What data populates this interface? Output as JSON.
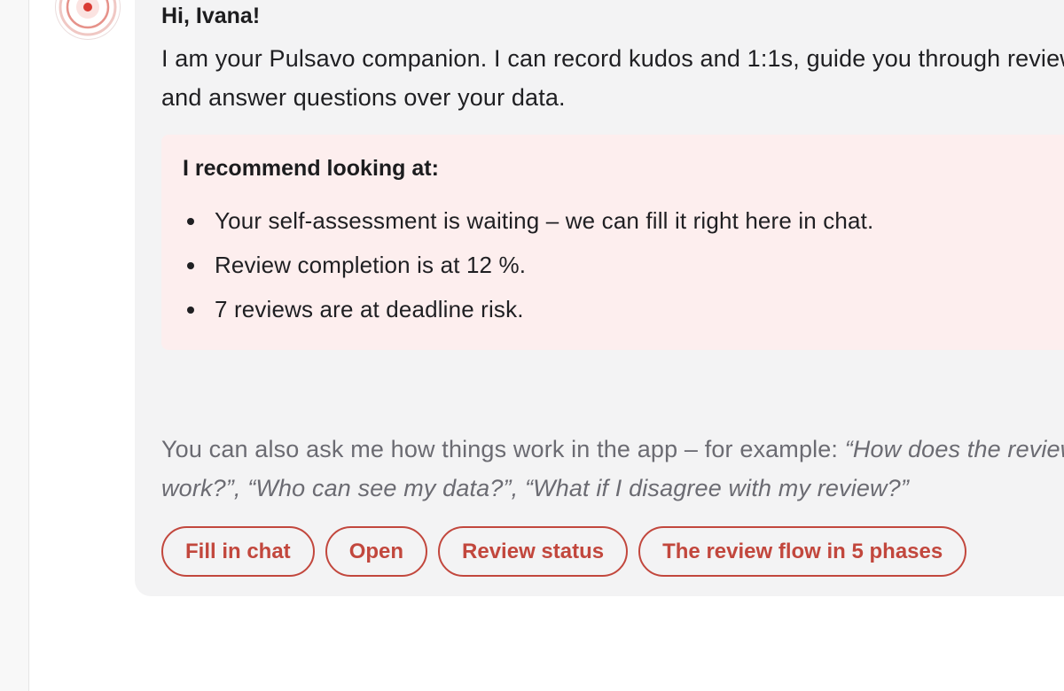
{
  "assistant": {
    "avatar_icon": "pulse-target-icon",
    "brand_color": "#c2473d"
  },
  "message": {
    "greeting": "Hi, Ivana!",
    "intro": "I am your Pulsavo companion. I can record kudos and 1:1s, guide you through reviews and answer questions over your data.",
    "recommendations": {
      "title": "I recommend looking at:",
      "items": [
        "Your self-assessment is waiting – we can fill it right here in chat.",
        "Review completion is at 12 %.",
        "7 reviews are at deadline risk."
      ]
    },
    "help_note": {
      "prefix": "You can also ask me how things work in the app – for example: ",
      "examples": "“How does the review work?”, “Who can see my data?”, “What if I disagree with my review?”"
    },
    "actions": [
      "Fill in chat",
      "Open",
      "Review status",
      "The review flow in 5 phases"
    ]
  }
}
